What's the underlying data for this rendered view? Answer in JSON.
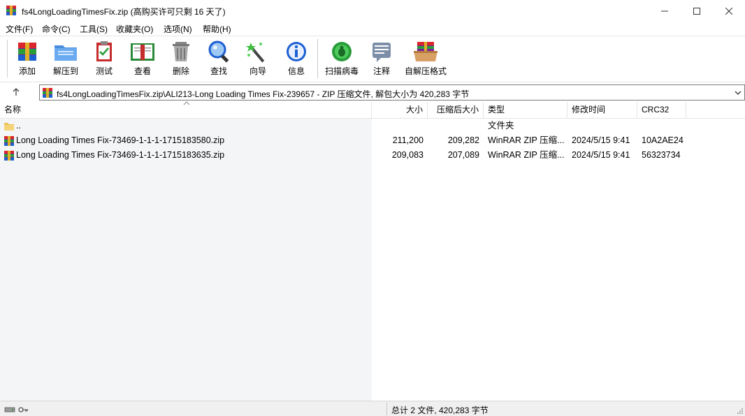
{
  "window": {
    "title": "fs4LongLoadingTimesFix.zip (高购买许可只剩 16 天了)",
    "controls": [
      "minimize-icon",
      "maximize-icon",
      "close-icon"
    ]
  },
  "menu": [
    "文件(F)",
    "命令(C)",
    "工具(S)",
    "收藏夹(O)",
    "选项(N)",
    "帮助(H)"
  ],
  "toolbar": [
    {
      "label": "添加",
      "icon": "add-archive-icon"
    },
    {
      "label": "解压到",
      "icon": "extract-to-folder-icon"
    },
    {
      "label": "测试",
      "icon": "test-clipboard-icon"
    },
    {
      "label": "查看",
      "icon": "view-book-icon"
    },
    {
      "label": "删除",
      "icon": "trash-bin-icon"
    },
    {
      "label": "查找",
      "icon": "magnifier-icon"
    },
    {
      "label": "向导",
      "icon": "wizard-wand-icon"
    },
    {
      "label": "信息",
      "icon": "info-icon"
    },
    {
      "label": "扫描病毒",
      "icon": "virus-scan-icon"
    },
    {
      "label": "注释",
      "icon": "comment-icon"
    },
    {
      "label": "自解压格式",
      "icon": "sfx-box-icon"
    }
  ],
  "address": {
    "path": "fs4LongLoadingTimesFix.zip\\ALI213-Long Loading Times Fix-239657 - ZIP 压缩文件, 解包大小为 420,283 字节"
  },
  "columns": [
    "名称",
    "大小",
    "压缩后大小",
    "类型",
    "修改时间",
    "CRC32"
  ],
  "rows": [
    {
      "name": "..",
      "size": "",
      "packed": "",
      "type": "文件夹",
      "modified": "",
      "crc": "",
      "icon": "folder-icon"
    },
    {
      "name": "Long Loading Times Fix-73469-1-1-1-1715183580.zip",
      "size": "211,200",
      "packed": "209,282",
      "type": "WinRAR ZIP 压缩...",
      "modified": "2024/5/15 9:41",
      "crc": "10A2AE24",
      "icon": "zip-archive-icon"
    },
    {
      "name": "Long Loading Times Fix-73469-1-1-1-1715183635.zip",
      "size": "209,083",
      "packed": "207,089",
      "type": "WinRAR ZIP 压缩...",
      "modified": "2024/5/15 9:41",
      "crc": "56323734",
      "icon": "zip-archive-icon"
    }
  ],
  "status": {
    "summary": "总计 2 文件, 420,283 字节"
  },
  "colors": {
    "accent": "#1c6fd1",
    "list_bg_left": "#f4f5f6"
  }
}
